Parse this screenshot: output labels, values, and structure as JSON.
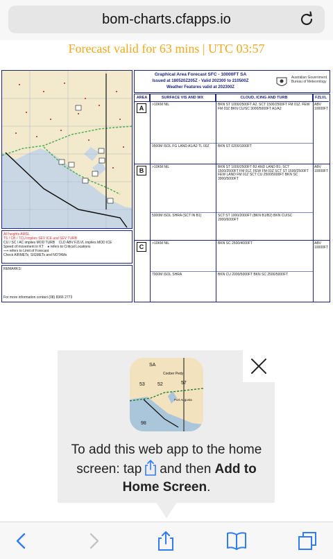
{
  "browser": {
    "url": "bom-charts.cfapps.io"
  },
  "page": {
    "forecast_banner": "Forecast valid for 63 mins | UTC 03:57"
  },
  "chart_header": {
    "title": "Graphical Area Forecast SFC - 10000FT SA",
    "issued": "Issued at 180520Z205Z - Valid 202300 to 210500Z",
    "weather": "Weather Features valid at 202300Z",
    "gov_line1": "Australian Government",
    "gov_line2": "Bureau of Meteorology"
  },
  "legend": {
    "line1": "All heights AMSL",
    "line2": "TS / CB / TCU implies SEV ICE and SEV TURB",
    "line3": "CU / SC / AC implies MOD TURB",
    "line3b": "CLD ABV FZLVL implies MOD ICE",
    "line4": "Speed of movement in KT",
    "line4b": "refers to Critical Locations",
    "line5": "refers to Limit of Forecast",
    "line6": "Check AIRMETs, SIGMETs and NOTAMs"
  },
  "remarks": {
    "label": "REMARKS:",
    "contact": "For more information contact (08) 8366 2773"
  },
  "table": {
    "headers": [
      "AREA",
      "SURFACE VIS AND WX",
      "CLOUD, ICING AND TURB",
      "FZLVL"
    ],
    "areas": [
      {
        "id": "A",
        "rows": [
          {
            "vis": ">10KM NIL",
            "cloud": "BKN ST 1000/2500FT A2. SCT 1500/2500FT FM 01Z. FEW FM 03Z BKN CU/SC 3000/5000FT A1/A2"
          },
          {
            "vis": "0500M ISOL FG LAND A1/A2 TL 00Z",
            "cloud": "BKN ST 0200/1000FT"
          }
        ],
        "fzlvl": "ABV 10000FT"
      },
      {
        "id": "B",
        "rows": [
          {
            "vis": ">10KM NIL",
            "cloud": "BKN ST 1000/2500FT B2 AND LAND B1; SCT 1500/2500FT FM 01Z, FEW FM 03Z SCT ST 1500/2500FT FEW LAND FM 01Z SCT CU 2500/5000FT BKN SC 3000/5000FT"
          },
          {
            "vis": "5000M ISOL SHRA (SCT IN B1)",
            "cloud": "SCT ST 1000/2000FT (BKN B1/B2) BKN CU/SC 2000/6000FT"
          }
        ],
        "fzlvl": "ABV 10000FT"
      },
      {
        "id": "C",
        "rows": [
          {
            "vis": ">10KM NIL",
            "cloud": "BKN SC 2500/4000FT"
          },
          {
            "vis": "7000M ISOL SHRA",
            "cloud": "BKN CU 2000/5000FT BKN SC 2500/5000FT"
          }
        ],
        "fzlvl": "ABV 10000FT"
      }
    ]
  },
  "popup": {
    "instruction_pre": "To add this web app to the home screen: tap",
    "instruction_mid": "and then",
    "instruction_bold": "Add to Home Screen",
    "instruction_end": ".",
    "icon_labels": [
      "SA",
      "53",
      "52",
      "Coober Pedy",
      "57",
      "Port Augusta",
      "98"
    ]
  }
}
